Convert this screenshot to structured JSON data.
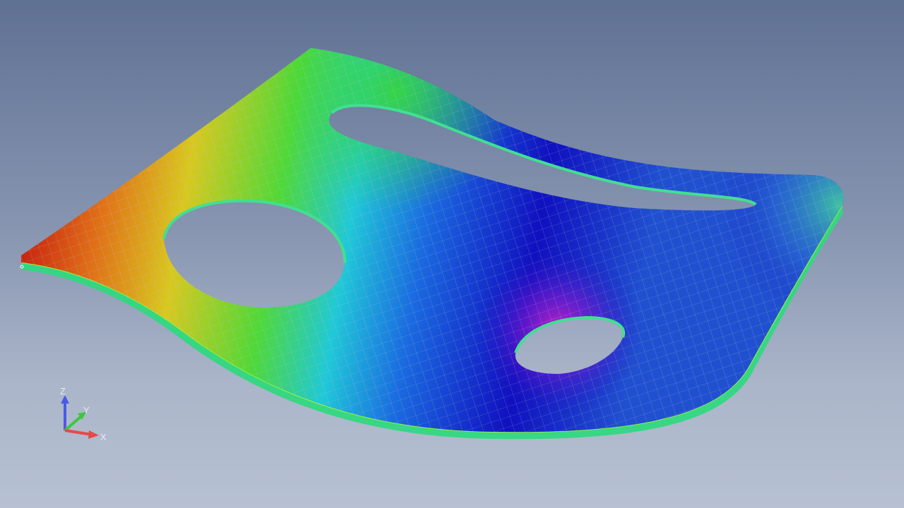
{
  "viewport": {
    "background_top": "#5f7193",
    "background_bottom": "#b7c1d3"
  },
  "model": {
    "contour_colors": [
      "#c8200f",
      "#e8901a",
      "#d8d020",
      "#5ad830",
      "#18d8d0",
      "#1a6fe0",
      "#1010c8",
      "#a018c8"
    ],
    "mesh_line_color": "#c8ccd6",
    "holes": 3
  },
  "triad": {
    "x_label": "X",
    "y_label": "Y",
    "z_label": "Z",
    "x_color": "#e84848",
    "y_color": "#3cc83c",
    "z_color": "#4a5ae8"
  }
}
